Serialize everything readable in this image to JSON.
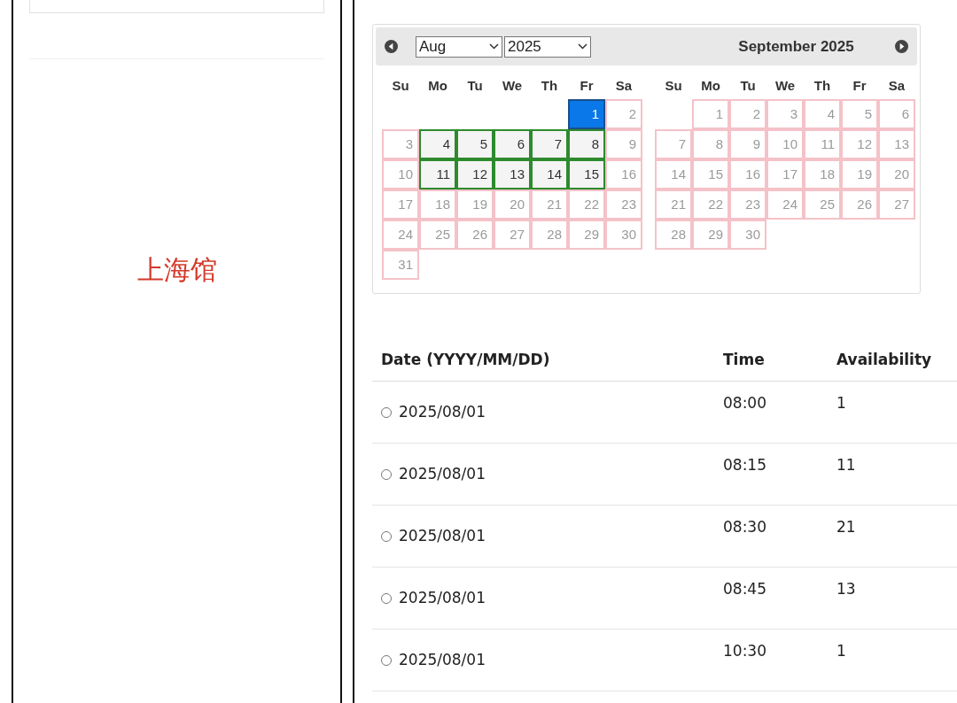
{
  "venue": {
    "name": "上海馆"
  },
  "calendar": {
    "month_select": "Aug",
    "year_select": "2025",
    "second_month_title": "September 2025",
    "months": [
      {
        "weekdays": [
          "Su",
          "Mo",
          "Tu",
          "We",
          "Th",
          "Fr",
          "Sa"
        ],
        "weeks": [
          [
            {
              "label": "1",
              "kind": "selected"
            },
            {
              "label": "2",
              "kind": "unavailable"
            }
          ],
          [
            {
              "label": "3",
              "kind": "unavailable"
            },
            {
              "label": "4",
              "kind": "available"
            },
            {
              "label": "5",
              "kind": "available"
            },
            {
              "label": "6",
              "kind": "available"
            },
            {
              "label": "7",
              "kind": "available"
            },
            {
              "label": "8",
              "kind": "available"
            },
            {
              "label": "9",
              "kind": "unavailable"
            }
          ],
          [
            {
              "label": "10",
              "kind": "unavailable"
            },
            {
              "label": "11",
              "kind": "available"
            },
            {
              "label": "12",
              "kind": "available"
            },
            {
              "label": "13",
              "kind": "available"
            },
            {
              "label": "14",
              "kind": "available"
            },
            {
              "label": "15",
              "kind": "available"
            },
            {
              "label": "16",
              "kind": "unavailable"
            }
          ],
          [
            {
              "label": "17",
              "kind": "unavailable"
            },
            {
              "label": "18",
              "kind": "unavailable"
            },
            {
              "label": "19",
              "kind": "unavailable"
            },
            {
              "label": "20",
              "kind": "unavailable"
            },
            {
              "label": "21",
              "kind": "unavailable"
            },
            {
              "label": "22",
              "kind": "unavailable"
            },
            {
              "label": "23",
              "kind": "unavailable"
            }
          ],
          [
            {
              "label": "24",
              "kind": "unavailable"
            },
            {
              "label": "25",
              "kind": "unavailable"
            },
            {
              "label": "26",
              "kind": "unavailable"
            },
            {
              "label": "27",
              "kind": "unavailable"
            },
            {
              "label": "28",
              "kind": "unavailable"
            },
            {
              "label": "29",
              "kind": "unavailable"
            },
            {
              "label": "30",
              "kind": "unavailable"
            }
          ],
          [
            {
              "label": "31",
              "kind": "unavailable"
            }
          ]
        ]
      },
      {
        "weekdays": [
          "Su",
          "Mo",
          "Tu",
          "We",
          "Th",
          "Fr",
          "Sa"
        ],
        "weeks": [
          [
            {
              "label": "1",
              "kind": "unavailable"
            },
            {
              "label": "2",
              "kind": "unavailable"
            },
            {
              "label": "3",
              "kind": "unavailable"
            },
            {
              "label": "4",
              "kind": "unavailable"
            },
            {
              "label": "5",
              "kind": "unavailable"
            },
            {
              "label": "6",
              "kind": "unavailable"
            }
          ],
          [
            {
              "label": "7",
              "kind": "unavailable"
            },
            {
              "label": "8",
              "kind": "unavailable"
            },
            {
              "label": "9",
              "kind": "unavailable"
            },
            {
              "label": "10",
              "kind": "unavailable"
            },
            {
              "label": "11",
              "kind": "unavailable"
            },
            {
              "label": "12",
              "kind": "unavailable"
            },
            {
              "label": "13",
              "kind": "unavailable"
            }
          ],
          [
            {
              "label": "14",
              "kind": "unavailable"
            },
            {
              "label": "15",
              "kind": "unavailable"
            },
            {
              "label": "16",
              "kind": "unavailable"
            },
            {
              "label": "17",
              "kind": "unavailable"
            },
            {
              "label": "18",
              "kind": "unavailable"
            },
            {
              "label": "19",
              "kind": "unavailable"
            },
            {
              "label": "20",
              "kind": "unavailable"
            }
          ],
          [
            {
              "label": "21",
              "kind": "unavailable"
            },
            {
              "label": "22",
              "kind": "unavailable"
            },
            {
              "label": "23",
              "kind": "unavailable"
            },
            {
              "label": "24",
              "kind": "unavailable"
            },
            {
              "label": "25",
              "kind": "unavailable"
            },
            {
              "label": "26",
              "kind": "unavailable"
            },
            {
              "label": "27",
              "kind": "unavailable"
            }
          ],
          [
            {
              "label": "28",
              "kind": "unavailable"
            },
            {
              "label": "29",
              "kind": "unavailable"
            },
            {
              "label": "30",
              "kind": "unavailable"
            }
          ]
        ]
      }
    ]
  },
  "table": {
    "columns": [
      "Date (YYYY/MM/DD)",
      "Time",
      "Availability"
    ],
    "rows": [
      {
        "date": "2025/08/01",
        "time": "08:00",
        "availability": "1",
        "selected": false
      },
      {
        "date": "2025/08/01",
        "time": "08:15",
        "availability": "11",
        "selected": false
      },
      {
        "date": "2025/08/01",
        "time": "08:30",
        "availability": "21",
        "selected": false
      },
      {
        "date": "2025/08/01",
        "time": "08:45",
        "availability": "13",
        "selected": false
      },
      {
        "date": "2025/08/01",
        "time": "10:30",
        "availability": "1",
        "selected": false
      }
    ]
  }
}
